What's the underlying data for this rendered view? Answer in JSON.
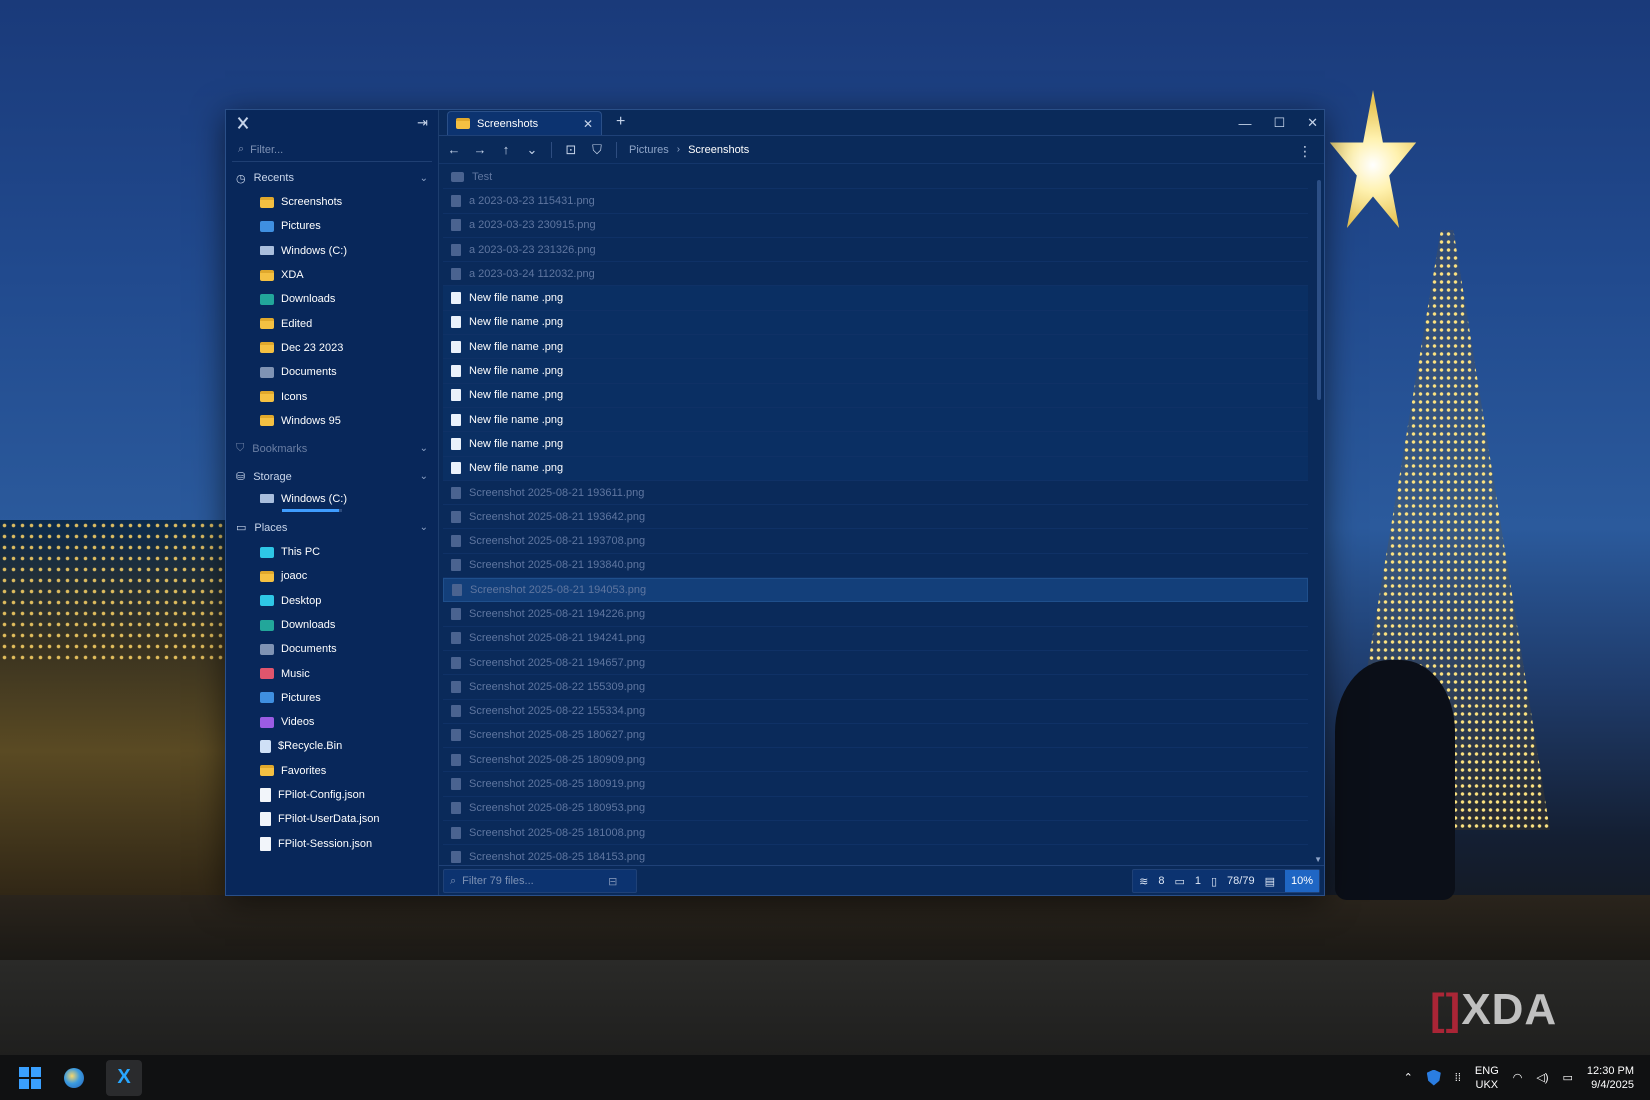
{
  "colors": {
    "accent": "#3f9dff",
    "window_bg": "#0a2a5a",
    "taskbar_bg": "#101112"
  },
  "sidebar": {
    "filter_placeholder": "Filter...",
    "recents_label": "Recents",
    "recents": [
      {
        "label": "Screenshots",
        "icon": "folder-icon"
      },
      {
        "label": "Pictures",
        "icon": "pictures-icon"
      },
      {
        "label": "Windows (C:)",
        "icon": "drive-icon"
      },
      {
        "label": "XDA",
        "icon": "folder-icon"
      },
      {
        "label": "Downloads",
        "icon": "downloads-icon"
      },
      {
        "label": "Edited",
        "icon": "folder-icon"
      },
      {
        "label": "Dec 23 2023",
        "icon": "folder-icon"
      },
      {
        "label": "Documents",
        "icon": "documents-icon"
      },
      {
        "label": "Icons",
        "icon": "folder-icon"
      },
      {
        "label": "Windows 95",
        "icon": "folder-icon"
      }
    ],
    "bookmarks_label": "Bookmarks",
    "storage_label": "Storage",
    "storage": {
      "label": "Windows (C:)",
      "used_fraction": 0.95
    },
    "places_label": "Places",
    "places": [
      {
        "label": "This PC",
        "icon": "pc-icon"
      },
      {
        "label": "joaoc",
        "icon": "folder-icon"
      },
      {
        "label": "Desktop",
        "icon": "desktop-icon"
      },
      {
        "label": "Downloads",
        "icon": "downloads-icon"
      },
      {
        "label": "Documents",
        "icon": "documents-icon"
      },
      {
        "label": "Music",
        "icon": "music-icon"
      },
      {
        "label": "Pictures",
        "icon": "pictures-icon"
      },
      {
        "label": "Videos",
        "icon": "videos-icon"
      },
      {
        "label": "$Recycle.Bin",
        "icon": "recycle-bin-icon"
      },
      {
        "label": "Favorites",
        "icon": "favorites-icon"
      },
      {
        "label": "FPilot-Config.json",
        "icon": "file-icon"
      },
      {
        "label": "FPilot-UserData.json",
        "icon": "file-icon"
      },
      {
        "label": "FPilot-Session.json",
        "icon": "file-icon"
      }
    ]
  },
  "tab": {
    "label": "Screenshots"
  },
  "breadcrumb": {
    "parent": "Pictures",
    "current": "Screenshots"
  },
  "files": [
    {
      "name": "Test",
      "type": "folder",
      "bright": false
    },
    {
      "name": "a 2023-03-23 115431.png",
      "bright": false
    },
    {
      "name": "a 2023-03-23 230915.png",
      "bright": false
    },
    {
      "name": "a 2023-03-23 231326.png",
      "bright": false
    },
    {
      "name": "a 2023-03-24 112032.png",
      "bright": false
    },
    {
      "name": "New file name .png",
      "bright": true
    },
    {
      "name": "New file name .png",
      "bright": true
    },
    {
      "name": "New file name .png",
      "bright": true
    },
    {
      "name": "New file name .png",
      "bright": true
    },
    {
      "name": "New file name .png",
      "bright": true
    },
    {
      "name": "New file name .png",
      "bright": true
    },
    {
      "name": "New file name .png",
      "bright": true
    },
    {
      "name": "New file name .png",
      "bright": true
    },
    {
      "name": "Screenshot 2025-08-21 193611.png",
      "bright": false
    },
    {
      "name": "Screenshot 2025-08-21 193642.png",
      "bright": false
    },
    {
      "name": "Screenshot 2025-08-21 193708.png",
      "bright": false
    },
    {
      "name": "Screenshot 2025-08-21 193840.png",
      "bright": false
    },
    {
      "name": "Screenshot 2025-08-21 194053.png",
      "bright": false,
      "selected": true
    },
    {
      "name": "Screenshot 2025-08-21 194226.png",
      "bright": false
    },
    {
      "name": "Screenshot 2025-08-21 194241.png",
      "bright": false
    },
    {
      "name": "Screenshot 2025-08-21 194657.png",
      "bright": false
    },
    {
      "name": "Screenshot 2025-08-22 155309.png",
      "bright": false
    },
    {
      "name": "Screenshot 2025-08-22 155334.png",
      "bright": false
    },
    {
      "name": "Screenshot 2025-08-25 180627.png",
      "bright": false
    },
    {
      "name": "Screenshot 2025-08-25 180909.png",
      "bright": false
    },
    {
      "name": "Screenshot 2025-08-25 180919.png",
      "bright": false
    },
    {
      "name": "Screenshot 2025-08-25 180953.png",
      "bright": false
    },
    {
      "name": "Screenshot 2025-08-25 181008.png",
      "bright": false
    },
    {
      "name": "Screenshot 2025-08-25 184153.png",
      "bright": false
    }
  ],
  "status": {
    "filter_placeholder": "Filter 79 files...",
    "selected_count": "8",
    "folder_count": "1",
    "file_count": "78/79",
    "zoom": "10%"
  },
  "taskbar": {
    "language": "ENG",
    "layout": "UKX",
    "time": "12:30 PM",
    "date": "9/4/2025"
  },
  "watermark": {
    "mark": "[]",
    "text": "XDA"
  }
}
